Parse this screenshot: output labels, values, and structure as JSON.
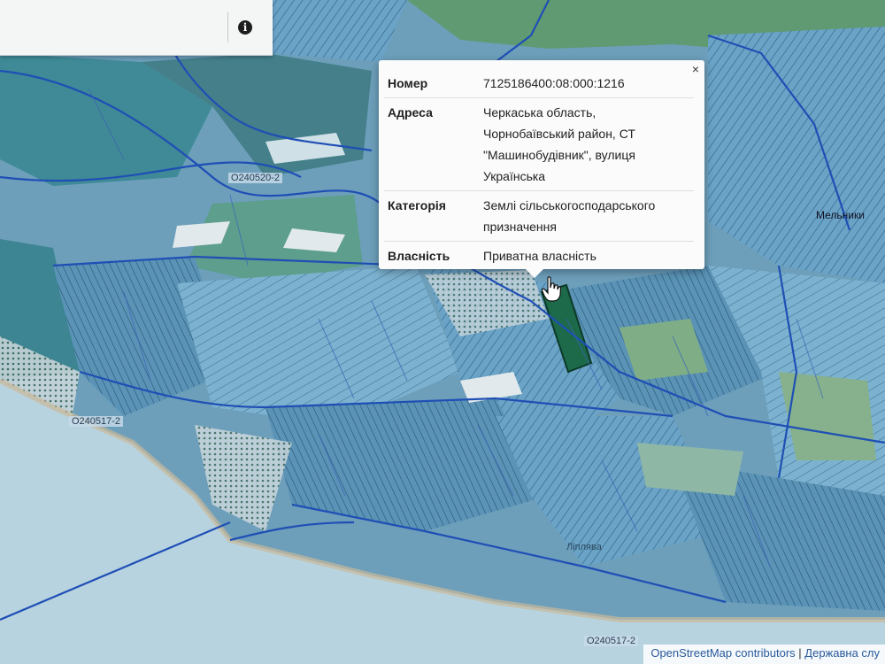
{
  "popup": {
    "close_glyph": "×",
    "rows": [
      {
        "key": "Номер",
        "value": "7125186400:08:000:1216"
      },
      {
        "key": "Адреса",
        "value": "Черкаська область, Чорнобаївський район, СТ \"Машинобудівник\", вулиця Українська"
      },
      {
        "key": "Категорія",
        "value": "Землі сільськогосподарського призначення"
      },
      {
        "key": "Власність",
        "value": "Приватна власність"
      }
    ]
  },
  "search_bar": {
    "info_glyph": "i"
  },
  "map_labels": {
    "road_1": "O240520-2",
    "road_2": "O240517-2",
    "road_3": "O240517-2",
    "place_1": "Мельники",
    "place_2": "Ліплява"
  },
  "attribution": {
    "osm": "OpenStreetMap contributors",
    "separator": "|",
    "source": "Державна слу"
  },
  "colors": {
    "water": "#a9c9d8",
    "parcel_blue": "#5e9cc2",
    "parcel_teal": "#3f8a96",
    "parcel_green": "#6fa07a",
    "boundary": "#1f4fb5"
  }
}
